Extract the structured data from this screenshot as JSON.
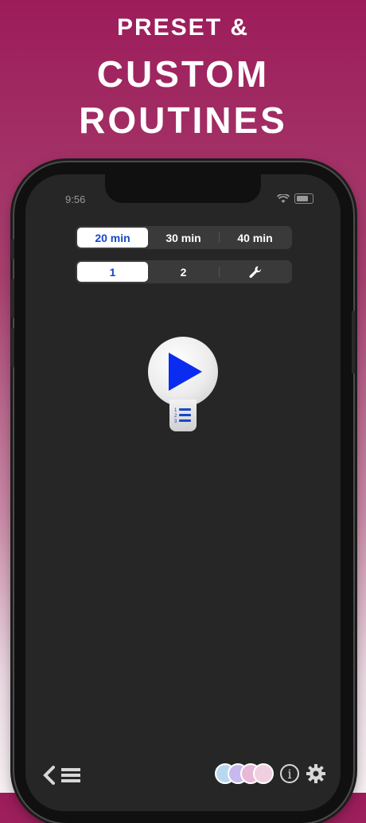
{
  "headline": {
    "line1": "PRESET &",
    "line2": "CUSTOM",
    "line3": "ROUTINES"
  },
  "status_bar": {
    "time": "9:56",
    "icons": [
      "wifi-icon",
      "battery-icon"
    ]
  },
  "duration_selector": {
    "options": [
      "20 min",
      "30 min",
      "40 min"
    ],
    "selected": "20 min"
  },
  "routine_selector": {
    "options": [
      "1",
      "2"
    ],
    "selected": "1",
    "extra_icon": "wrench-icon"
  },
  "controls": {
    "play_icon": "play-icon",
    "list_icon": "numbered-list-icon"
  },
  "bottom_bar": {
    "left_icons": [
      "back-chevron-icon",
      "menu-icon"
    ],
    "right_icons": [
      "routines-stack-icon",
      "info-icon",
      "gear-icon"
    ],
    "info_glyph": "i"
  },
  "colors": {
    "accent_blue": "#1846c8",
    "play_blue": "#0a2cf0",
    "screen_bg": "#262626"
  }
}
